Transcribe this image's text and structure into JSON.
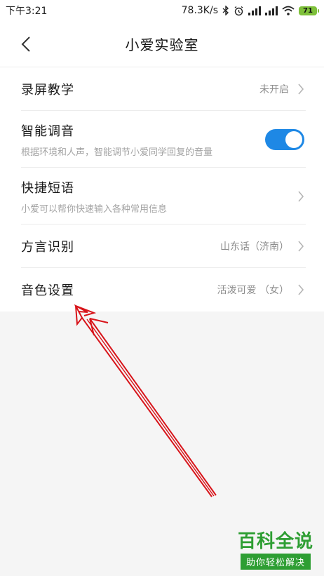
{
  "status_bar": {
    "time": "下午3:21",
    "net_speed": "78.3K/s",
    "battery": "71"
  },
  "header": {
    "title": "小爱实验室"
  },
  "settings": [
    {
      "title": "录屏教学",
      "value": "未开启"
    },
    {
      "title": "智能调音",
      "subtitle": "根据环境和人声，智能调节小爱同学回复的音量",
      "toggle_on": true
    },
    {
      "title": "快捷短语",
      "subtitle": "小爱可以帮你快速输入各种常用信息"
    },
    {
      "title": "方言识别",
      "value": "山东话（济南）"
    },
    {
      "title": "音色设置",
      "value": "活泼可爱 （女）"
    }
  ],
  "colors": {
    "toggle_on": "#1e88e5",
    "annotation_arrow": "#d8141a",
    "watermark": "#2e9e33"
  },
  "watermark": {
    "title": "百科全说",
    "subtitle": "助你轻松解决"
  }
}
